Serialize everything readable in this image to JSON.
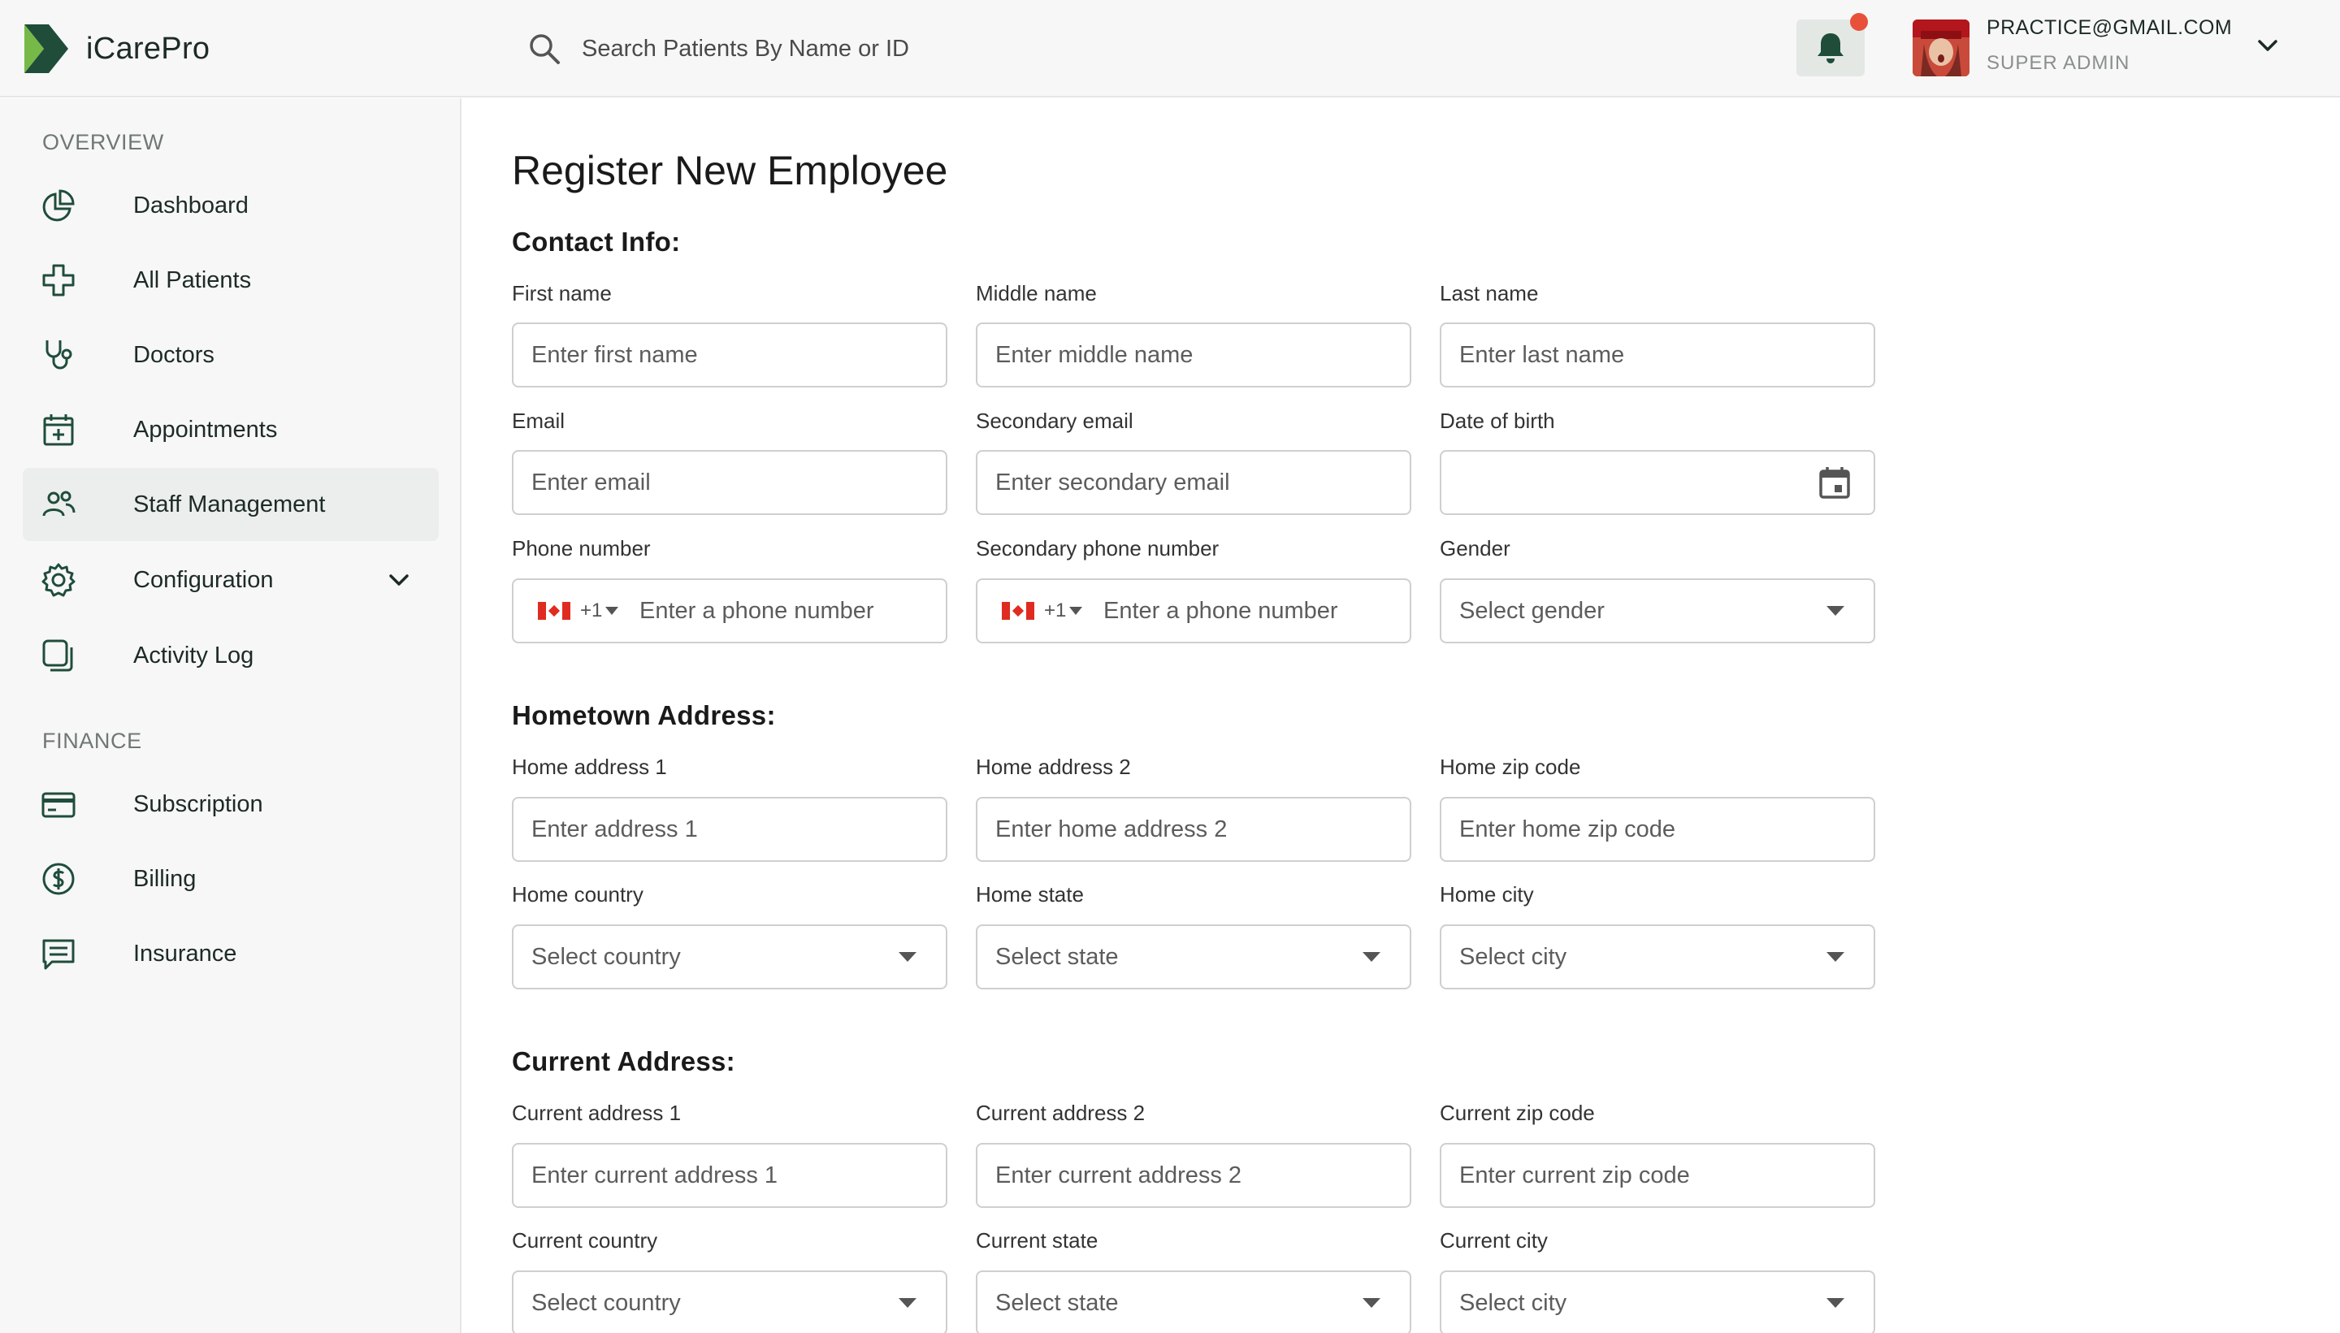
{
  "header": {
    "logo_text": "iCarePro",
    "search_placeholder": "Search Patients By Name or ID",
    "user_email": "PRACTICE@GMAIL.COM",
    "user_role": "SUPER ADMIN"
  },
  "sidebar": {
    "overview_label": "OVERVIEW",
    "finance_label": "FINANCE",
    "items": [
      {
        "label": "Dashboard",
        "icon": "pie-chart-icon"
      },
      {
        "label": "All Patients",
        "icon": "medical-cross-icon"
      },
      {
        "label": "Doctors",
        "icon": "stethoscope-icon"
      },
      {
        "label": "Appointments",
        "icon": "calendar-plus-icon"
      },
      {
        "label": "Staff Management",
        "icon": "users-icon",
        "active": true
      },
      {
        "label": "Configuration",
        "icon": "gear-icon",
        "expandable": true
      },
      {
        "label": "Activity Log",
        "icon": "copy-icon"
      }
    ],
    "finance_items": [
      {
        "label": "Subscription",
        "icon": "credit-card-icon"
      },
      {
        "label": "Billing",
        "icon": "dollar-circle-icon"
      },
      {
        "label": "Insurance",
        "icon": "document-icon"
      }
    ]
  },
  "main": {
    "title": "Register New Employee",
    "contact": {
      "title": "Contact Info:",
      "first_name": {
        "label": "First name",
        "placeholder": "Enter first name"
      },
      "middle_name": {
        "label": "Middle name",
        "placeholder": "Enter middle name"
      },
      "last_name": {
        "label": "Last name",
        "placeholder": "Enter last name"
      },
      "email": {
        "label": "Email",
        "placeholder": "Enter email"
      },
      "secondary_email": {
        "label": "Secondary email",
        "placeholder": "Enter secondary email"
      },
      "dob": {
        "label": "Date of birth",
        "value": ""
      },
      "phone": {
        "label": "Phone number",
        "dial": "+1",
        "placeholder": "Enter a phone number"
      },
      "secondary_phone": {
        "label": "Secondary phone number",
        "dial": "+1",
        "placeholder": "Enter a phone number"
      },
      "gender": {
        "label": "Gender",
        "value": "Select gender"
      }
    },
    "hometown": {
      "title": "Hometown Address:",
      "address1": {
        "label": "Home address 1",
        "placeholder": "Enter address 1"
      },
      "address2": {
        "label": "Home address 2",
        "placeholder": "Enter home address 2"
      },
      "zip": {
        "label": "Home zip code",
        "placeholder": "Enter home zip code"
      },
      "country": {
        "label": "Home country",
        "value": "Select country"
      },
      "state": {
        "label": "Home state",
        "value": "Select state"
      },
      "city": {
        "label": "Home city",
        "value": "Select city"
      }
    },
    "current": {
      "title": "Current Address:",
      "address1": {
        "label": "Current address 1",
        "placeholder": "Enter current address 1"
      },
      "address2": {
        "label": "Current address 2",
        "placeholder": "Enter current address 2"
      },
      "zip": {
        "label": "Current zip code",
        "placeholder": "Enter current zip code"
      },
      "country": {
        "label": "Current country",
        "value": "Select country"
      },
      "state": {
        "label": "Current state",
        "value": "Select state"
      },
      "city": {
        "label": "Current city",
        "value": "Select city"
      }
    }
  },
  "colors": {
    "brand_green": "#1f4d3a",
    "brand_light_green": "#76b947",
    "notification": "#e8503a",
    "active_nav_bg": "#ebeeec"
  }
}
